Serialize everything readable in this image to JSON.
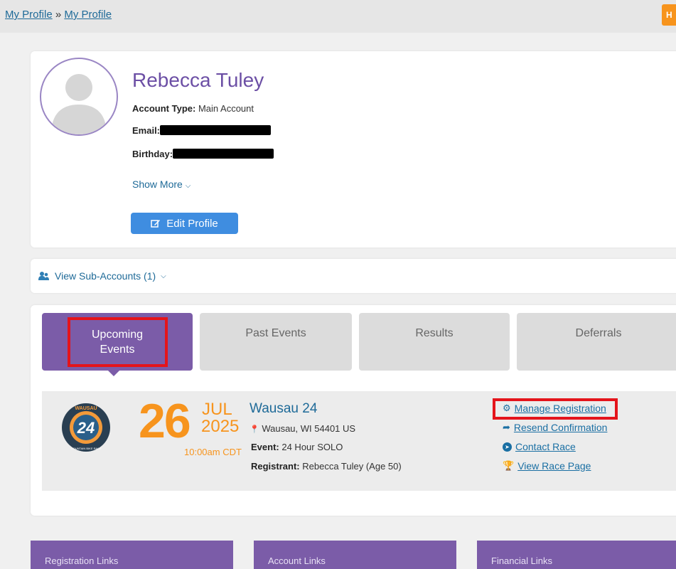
{
  "breadcrumb": {
    "item1": "My Profile",
    "separator": "»",
    "item2": "My Profile"
  },
  "help_tab": {
    "label": "H"
  },
  "profile": {
    "name": "Rebecca Tuley",
    "account_type_label": "Account Type:",
    "account_type_value": "Main Account",
    "email_label": "Email:",
    "birthday_label": "Birthday:",
    "show_more": "Show More",
    "edit_profile": "Edit Profile"
  },
  "sub_accounts": {
    "label": "View Sub-Accounts (1)"
  },
  "tabs": [
    {
      "label": "Upcoming Events",
      "active": true
    },
    {
      "label": "Past Events",
      "active": false
    },
    {
      "label": "Results",
      "active": false
    },
    {
      "label": "Deferrals",
      "active": false
    }
  ],
  "event": {
    "logo_top_text": "WAUSAU",
    "logo_number": "24",
    "logo_bottom_text": "MOUNTAIN BIKE RACE",
    "day": "26",
    "month": "JUL",
    "year": "2025",
    "time": "10:00am CDT",
    "title": "Wausau 24",
    "location": "Wausau, WI 54401 US",
    "event_label": "Event:",
    "event_value": "24 Hour SOLO",
    "registrant_label": "Registrant:",
    "registrant_value": "Rebecca Tuley (Age 50)",
    "actions": {
      "manage": "Manage Registration",
      "resend": "Resend Confirmation",
      "contact": "Contact Race",
      "view": "View Race Page"
    }
  },
  "bottom_boxes": [
    "Registration Links",
    "Account Links",
    "Financial Links"
  ],
  "colors": {
    "purple": "#7b5ca8",
    "orange": "#f7941d",
    "link": "#1a6fa3",
    "highlight": "#e4141b",
    "button": "#3f8de0"
  }
}
